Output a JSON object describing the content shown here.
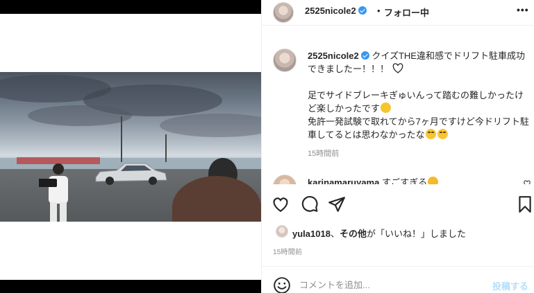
{
  "post": {
    "username": "2525nicole2",
    "follow_separator": "•",
    "follow_status": "フォロー中",
    "more_label": "•••"
  },
  "caption": {
    "username": "2525nicole2",
    "line1": "クイズTHE違和感でドリフト駐車成功できましたー！！！",
    "line2": "足でサイドブレーキぎゅいんって踏むの難しかったけど楽しかったです",
    "line3": "免許一発試験で取れてから7ヶ月ですけど今ドリフト駐車してるとは思わなかったな",
    "time": "15時間前"
  },
  "comment": {
    "username": "karinamaruyama",
    "text": "すごすぎる"
  },
  "likes": {
    "user": "yula1018",
    "middle": "、",
    "others": "その他",
    "suffix": "が「いいね！」しました"
  },
  "post_time": "15時間前",
  "add_comment": {
    "placeholder": "コメントを追加...",
    "post_label": "投稿する"
  },
  "icons": {
    "like": "heart-outline-icon",
    "comment": "comment-bubble-icon",
    "share": "paper-plane-icon",
    "save": "bookmark-icon",
    "emoji": "smiley-icon",
    "verified": "verified-badge-icon"
  },
  "colors": {
    "verified": "#3897f0",
    "post_button_disabled": "#b2dffc",
    "secondary_text": "#8e8e8e"
  }
}
